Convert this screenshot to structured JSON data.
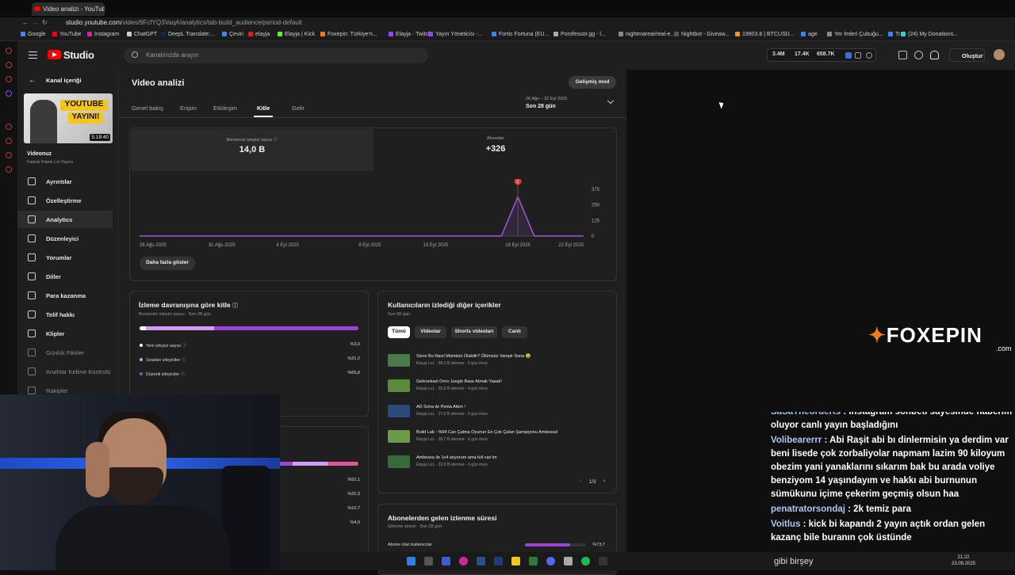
{
  "browser": {
    "tab_title": "Video analizi - YouTube S",
    "url_host": "studio.youtube.com",
    "url_path": "/video/9FcfYQ3VaqA/analytics/tab-build_audience/period-default",
    "bookmarks": [
      {
        "label": "Google",
        "color": "#4285f4"
      },
      {
        "label": "YouTube",
        "color": "#ff0000"
      },
      {
        "label": "Instagram",
        "color": "#d6249f"
      },
      {
        "label": "ChatGPT",
        "color": "#cccccc"
      },
      {
        "label": "DeepL Translate:...",
        "color": "#0f2b46"
      },
      {
        "label": "Çeviri",
        "color": "#4285f4"
      },
      {
        "label": "elayja",
        "color": "#e91916"
      },
      {
        "label": "Elayja | Kick",
        "color": "#53fc18"
      },
      {
        "label": "Foxepin: Türkiye'n...",
        "color": "#f07a1a"
      },
      {
        "label": "Elayja - Twitch",
        "color": "#9146ff"
      },
      {
        "label": "Yayın Yöneticisi -...",
        "color": "#9146ff"
      },
      {
        "label": "Fortis Fortuna (EU...",
        "color": "#3b82f6"
      },
      {
        "label": "Porofessor.gg - l...",
        "color": "#aaaaaa"
      },
      {
        "label": "nightmareai/real-e...",
        "color": "#888888"
      },
      {
        "label": "Nightbot - Giveaw...",
        "color": "#555555"
      },
      {
        "label": "19903.8 | BTCUSD...",
        "color": "#f7931a"
      },
      {
        "label": "age",
        "color": "#3b82f6"
      },
      {
        "label": "Yer İmleri Çubuğu...",
        "color": "#888888"
      },
      {
        "label": "Tr",
        "color": "#3b82f6"
      },
      {
        "label": "(24) My Donations...",
        "color": "#2dd4bf"
      }
    ]
  },
  "header": {
    "logo_text": "Studio",
    "search_placeholder": "Kanalınızda arayın",
    "stats": [
      "3.4M",
      "17.4K",
      "658.7K"
    ],
    "create_label": "Oluştur"
  },
  "sidebar": {
    "back_label": "Kanal içeriği",
    "thumb_line1": "YOUTUBE",
    "thumb_line2": "YAYINI!",
    "duration": "5:19:40",
    "video_label": "Videonuz",
    "video_title": "Falanlı Filanlı Lol Yayını",
    "items": [
      {
        "label": "Ayrıntılar",
        "icon": "pencil-icon"
      },
      {
        "label": "Özelleştirme",
        "icon": "broadcast-icon"
      },
      {
        "label": "Analytics",
        "icon": "analytics-icon"
      },
      {
        "label": "Düzenleyici",
        "icon": "editor-icon"
      },
      {
        "label": "Yorumlar",
        "icon": "comments-icon"
      },
      {
        "label": "Diller",
        "icon": "subtitles-icon"
      },
      {
        "label": "Para kazanma",
        "icon": "dollar-icon"
      },
      {
        "label": "Telif hakkı",
        "icon": "copyright-icon"
      },
      {
        "label": "Klipler",
        "icon": "clips-icon"
      },
      {
        "label": "Günlük Fikirler",
        "icon": "ideas-icon"
      },
      {
        "label": "Anahtar Kelime Kontrolü",
        "icon": "keyword-icon"
      },
      {
        "label": "Rakipler",
        "icon": "competitors-icon"
      }
    ]
  },
  "main": {
    "title": "Video analizi",
    "advanced_label": "Gelişmiş mod",
    "tabs": [
      "Genel bakış",
      "Erişim",
      "Etkileşim",
      "Kitle",
      "Gelir"
    ],
    "date_range": "26 Ağu – 22 Eyl 2025",
    "date_select": "Son 28 gün",
    "kpi1_label": "Benzersiz izleyici sayısı",
    "kpi1_value": "14,0 B",
    "kpi2_label": "Aboneler",
    "kpi2_value": "+326",
    "more_label": "Daha fazla göster",
    "behavior": {
      "title": "İzleme davranışına göre kitle",
      "subtitle": "Benzersiz izleyici sayısı · Son 28 gün",
      "rows": [
        {
          "label": "Yeni izleyici sayısı",
          "value": "%3,0",
          "color": "#ffffff"
        },
        {
          "label": "Sıradan izleyiciler",
          "value": "%31,2",
          "color": "#d49cf5"
        },
        {
          "label": "Düzenli izleyiciler",
          "value": "%65,8",
          "color": "#9e44d4"
        }
      ]
    },
    "second_card_values": [
      "%52,1",
      "%32,3",
      "%10,7",
      "%4,9"
    ],
    "other_content": {
      "title": "Kullanıcıların izlediği diğer içerikler",
      "subtitle": "Son 90 gün",
      "filters": [
        "Tümü",
        "Videolar",
        "Shorts videoları",
        "Canlı"
      ],
      "videos": [
        {
          "title": "Sizce Bu Nasıl Mümkün Olabilir? Ölümsüz Vampir Sona 😂",
          "meta": "Elayja LoL · 68,3 B izlenme · 5 gün önce",
          "color": "#4a7a4a"
        },
        {
          "title": "Geleneksel Ornn Jungle Base Atmak Yasak!",
          "meta": "Elayja LoL · 55,8 B izlenme · 4 gün önce",
          "color": "#5a8a3a"
        },
        {
          "title": "AD Sona ile Penta Attım !",
          "meta": "Elayja LoL · 27,9 B izlenme · 5 gün önce",
          "color": "#2a4a7a"
        },
        {
          "title": "Build Lab : %94 Can Çalma Oyunun En Çok Çalan Şampiyonu Ambessa!",
          "meta": "Elayja LoL · 38,7 B izlenme · 6 gün önce",
          "color": "#6a9a4a"
        },
        {
          "title": "Ambessa ile 1v4 atıyorum ama full can'ım",
          "meta": "Elayja LoL · 32,8 B izlenme · 6 gün önce",
          "color": "#3a6a3a"
        }
      ],
      "pager": "1/3"
    },
    "subs_watch": {
      "title": "Abonelerden gelen izlenme süresi",
      "subtitle": "İzlenme süresi · Son 28 gün",
      "row_label": "Abone olan kullanıcılar",
      "row_value": "%73,7"
    }
  },
  "chart_data": {
    "type": "line",
    "x": [
      "26 Ağu 2025",
      "31 Ağu 2025",
      "4 Eyl 2025",
      "9 Eyl 2025",
      "13 Eyl 2025",
      "18 Eyl 2025",
      "22 Eyl 2025"
    ],
    "x_ticks": [
      "26 Ağu 2025",
      "31 Ağu 2025",
      "4 Eyl 2025",
      "9 Eyl 2025",
      "13 Eyl 2025",
      "18 Eyl 2025",
      "22 Eyl 2025"
    ],
    "y_ticks": [
      "375",
      "250",
      "125",
      "0"
    ],
    "ylim": [
      0,
      375
    ],
    "series": [
      {
        "values": [
          0,
          0,
          0,
          0,
          0,
          0,
          0,
          0,
          0,
          0,
          0,
          0,
          0,
          0,
          0,
          0,
          0,
          0,
          0,
          0,
          0,
          0,
          0,
          315,
          0,
          0,
          0,
          0
        ]
      }
    ],
    "color": "#a259d9",
    "marker_label": "!"
  },
  "overlay": {
    "brand_main": "FOXEPIN",
    "brand_sub": ".com",
    "chat": [
      {
        "user": "SaSaTheordeRs",
        "text": "instagram sohbeti sayesinde haberim oluyor canlı yayın başladığını"
      },
      {
        "user": "Volibearerrr",
        "text": "Abi Raşit abi bı dinlermisin ya derdim var beni lisede çok zorbaliyolar napmam lazim 90 kiloyum obezim yani yanaklarını sıkarım bak bu arada voliye benziyom 14 yaşındayım ve hakkı abi burnunun sümükunu içime çekerim geçmiş olsun haa"
      },
      {
        "user": "penatratorsondaj",
        "text": "2k temiz para"
      },
      {
        "user": "Voitlus",
        "text": "kick bi kapandı 2 yayın açtık ordan gelen kazanç bile buranın çok üstünde"
      }
    ],
    "chat_tail": "gibi birşey",
    "time": "21:22",
    "date": "23.09.2025"
  }
}
